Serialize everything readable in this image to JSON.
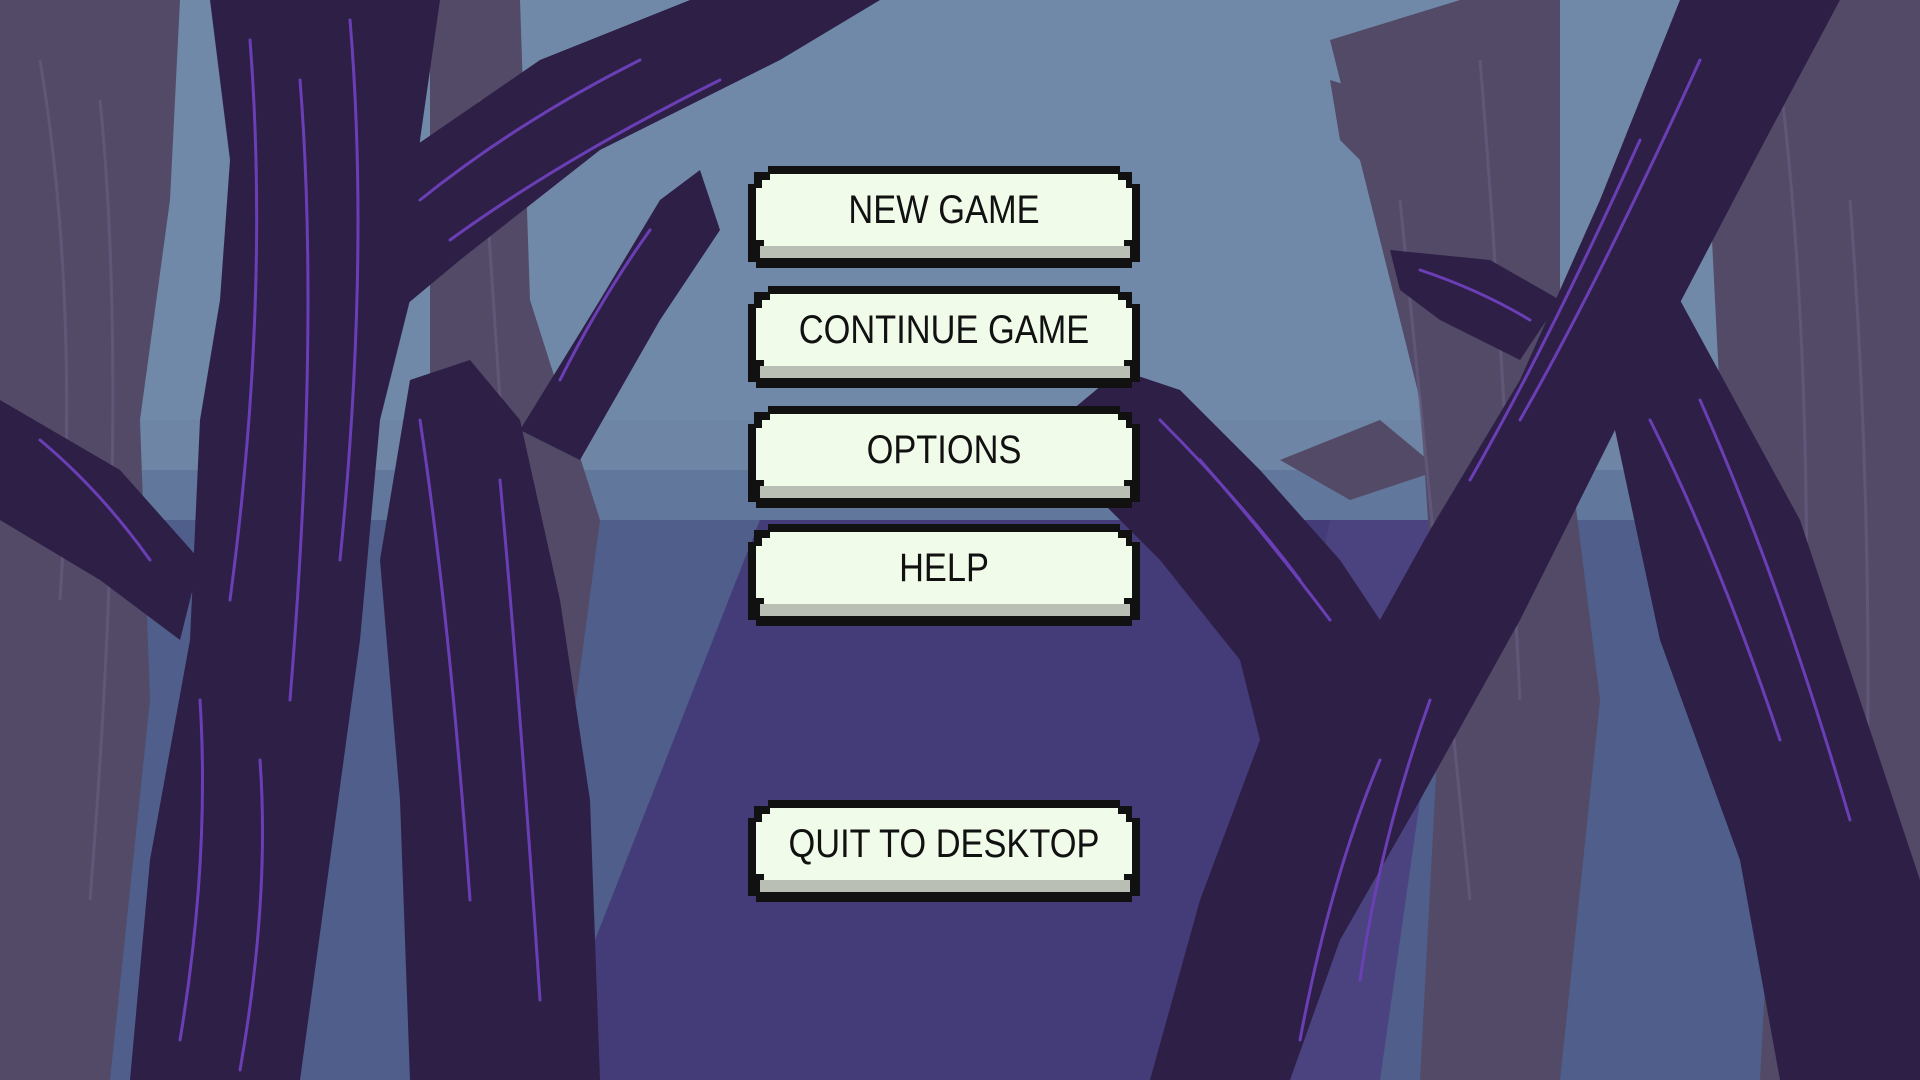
{
  "screen": "main-menu",
  "background": {
    "description_icon": "forest-trees-background",
    "sky_color": "#6e85a5",
    "path_color": "#443c78",
    "trunk_color": "#2e1f47",
    "grain_color": "#6a3fb5",
    "far_tree_color": "#524a66"
  },
  "menu": {
    "new_game_label": "NEW GAME",
    "continue_game_label": "CONTINUE GAME",
    "options_label": "OPTIONS",
    "help_label": "HELP",
    "quit_label": "QUIT TO DESKTOP"
  },
  "button_colors": {
    "face": "#f0fbe9",
    "border": "#111111",
    "shadow": "#b9bfb4"
  }
}
